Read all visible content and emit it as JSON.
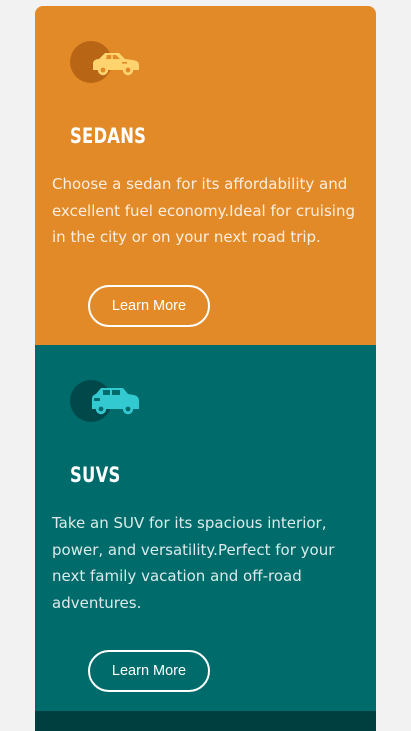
{
  "colors": {
    "page_background": "#f2f2f2",
    "sedan_card": "#e38a28",
    "suv_card": "#006b6b",
    "next_card": "#003f3f",
    "sedan_icon_circle": "#b86615",
    "sedan_icon_car": "#ffd36e",
    "suv_icon_circle": "#00484a",
    "suv_icon_car": "#33c9d1"
  },
  "cards": [
    {
      "icon": "sedan-car-icon",
      "title": "SEDANS",
      "description": "Choose a sedan for its affordability and excellent fuel economy.Ideal for cruising in the city or on your next road trip.",
      "button_label": "Learn More"
    },
    {
      "icon": "suv-car-icon",
      "title": "SUVS",
      "description": "Take an SUV for its spacious interior, power, and versatility.Perfect for your next family vacation and off-road adventures.",
      "button_label": "Learn More"
    }
  ]
}
